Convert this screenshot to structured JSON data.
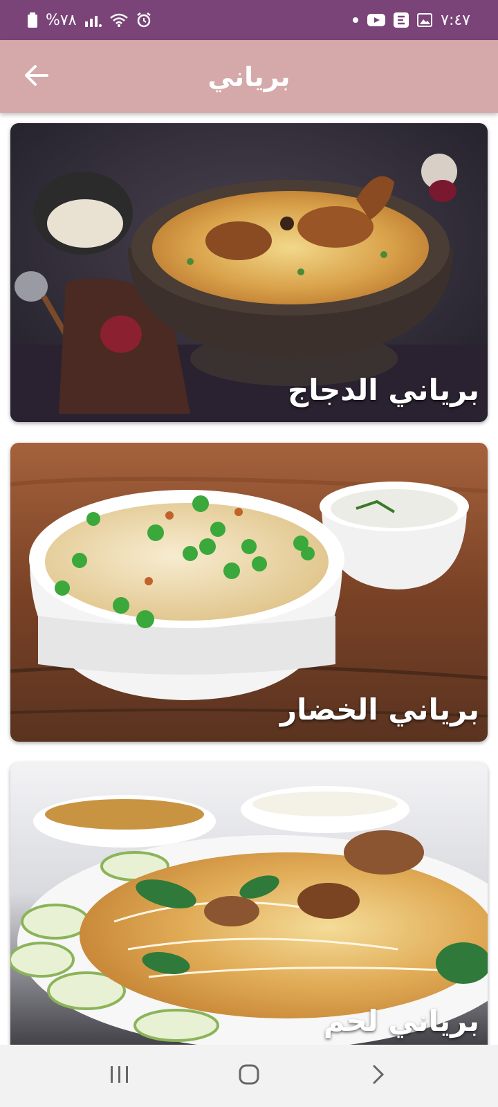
{
  "status_bar": {
    "battery_text": "%٧٨",
    "time": "٧:٤٧"
  },
  "app_bar": {
    "title": "برياني",
    "back_icon": "arrow-left-icon"
  },
  "cards": [
    {
      "title": "برياني الدجاج",
      "image": "chicken-biryani-photo"
    },
    {
      "title": "برياني الخضار",
      "image": "vegetable-biryani-photo"
    },
    {
      "title": "برياني لحم",
      "image": "meat-biryani-photo"
    }
  ],
  "nav_bar": {
    "recents_icon": "recents-icon",
    "home_icon": "home-icon",
    "back_icon": "back-chevron-icon"
  },
  "colors": {
    "status_bar": "#7a4478",
    "app_bar": "#d5a9a9",
    "nav_bar": "#f2f2f2"
  }
}
